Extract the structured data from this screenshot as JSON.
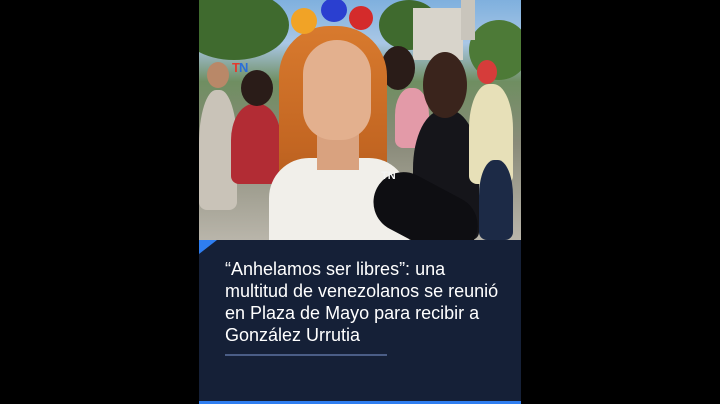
{
  "video": {
    "logo_t": "T",
    "logo_n": "N",
    "mic_logo": "TN"
  },
  "caption": {
    "headline": "“Anhelamos ser libres”: una multitud de venezolanos se reunió en Plaza de Mayo para recibir a González Urrutia"
  },
  "colors": {
    "caption_bg": "#152037",
    "accent": "#2f7ef0",
    "hair": "#c36622"
  }
}
